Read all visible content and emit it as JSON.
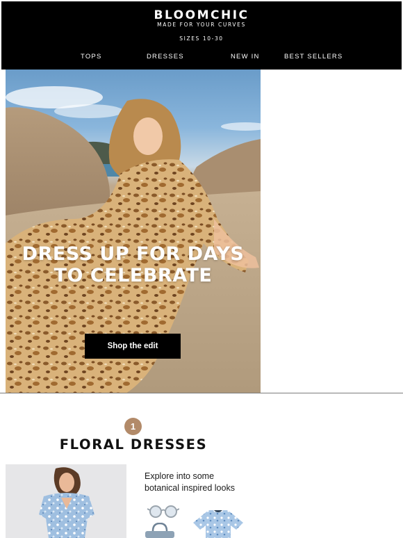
{
  "header": {
    "brand": "BLOOMCHIC",
    "tagline": "MADE FOR YOUR CURVES",
    "sizes": "SIZES 10-30",
    "nav": [
      {
        "label": "TOPS"
      },
      {
        "label": "DRESSES"
      },
      {
        "label": "NEW IN"
      },
      {
        "label": "BEST SELLERS"
      }
    ]
  },
  "hero": {
    "headline_line1": "DRESS UP FOR DAYS",
    "headline_line2": "TO CELEBRATE",
    "cta_label": "Shop the edit"
  },
  "section": {
    "step_number": "1",
    "title": "FLORAL DRESSES",
    "explore_text": "Explore into some botanical inspired looks"
  },
  "colors": {
    "header_bg": "#000000",
    "accent_badge": "#b28a69",
    "cta_bg": "#000000",
    "text": "#111111"
  },
  "icons": [
    "sunglasses-icon",
    "handbag-icon",
    "floral-top-icon"
  ]
}
